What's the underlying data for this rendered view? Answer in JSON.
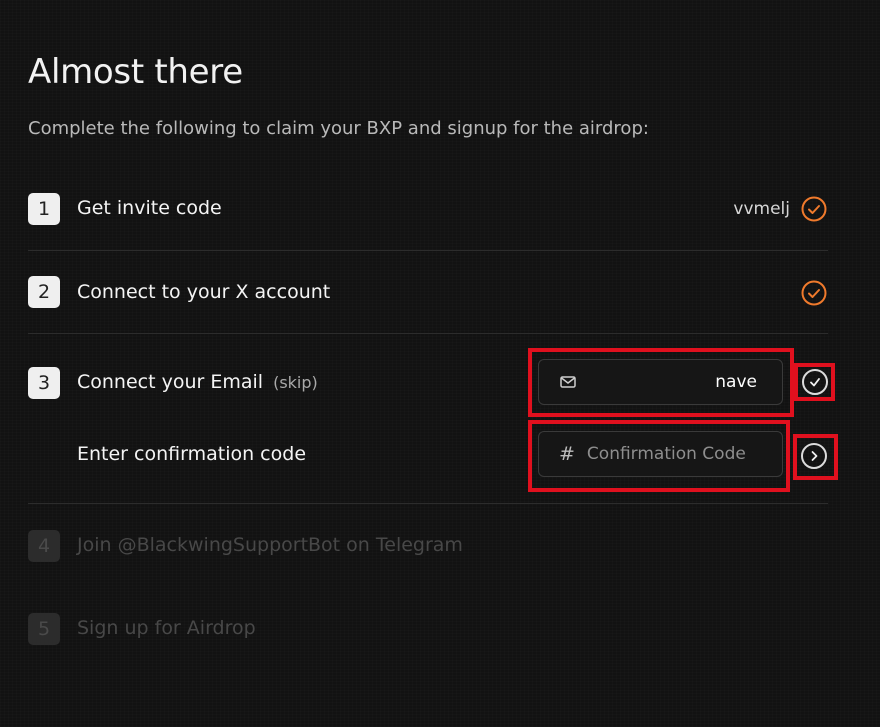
{
  "page": {
    "title": "Almost there",
    "subtitle": "Complete the following to claim your BXP and signup for the airdrop:"
  },
  "steps": [
    {
      "number": "1",
      "label": "Get invite code",
      "value": "vvmelj",
      "status": "done"
    },
    {
      "number": "2",
      "label": "Connect to your X account",
      "status": "done"
    },
    {
      "number": "3",
      "label": "Connect your Email",
      "skip_label": "(skip)",
      "status": "active"
    },
    {
      "number": "4",
      "label": "Join @BlackwingSupportBot on Telegram",
      "status": "disabled"
    },
    {
      "number": "5",
      "label": "Sign up for Airdrop",
      "status": "disabled"
    }
  ],
  "email": {
    "value": "nave",
    "icon": "mail-icon"
  },
  "confirmation": {
    "label": "Enter confirmation code",
    "placeholder": "Confirmation Code",
    "icon": "hash-icon"
  },
  "colors": {
    "accent": "#f07a2c",
    "highlight": "#e0101e",
    "background": "#121212"
  }
}
